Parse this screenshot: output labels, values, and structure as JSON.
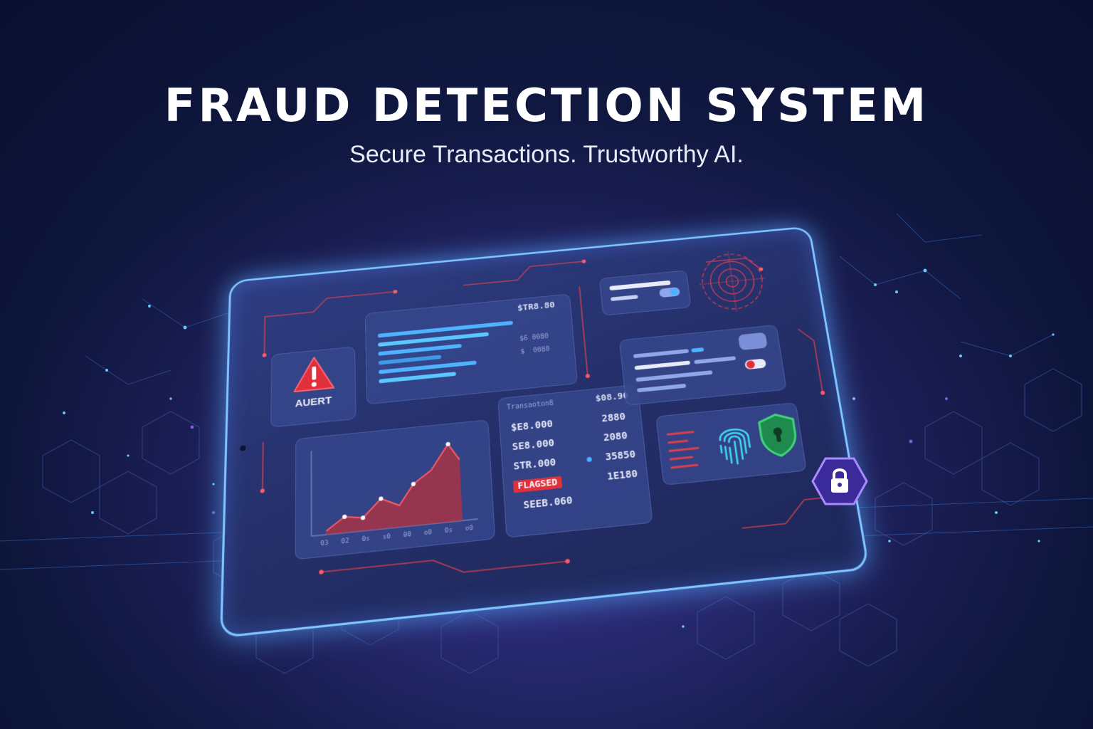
{
  "header": {
    "title": "FRAUD DETECTION SYSTEM",
    "subtitle": "Secure Transactions. Trustworthy AI."
  },
  "alert_card": {
    "label": "AUERT"
  },
  "bars_card": {
    "top_value": "$TR8.80",
    "row_values": [
      "$6 0080",
      "$  0080"
    ],
    "bar_color": "#4fb2ff"
  },
  "chart_card": {
    "tick_labels": [
      "03",
      "02",
      "0s",
      "s0",
      "00",
      "o0",
      "0s",
      "o0"
    ],
    "line_color": "#e04650",
    "fill_color": "#b8303c"
  },
  "transactions": {
    "header_left": "Transaoton8",
    "header_right": "$08.90",
    "rows": [
      {
        "left": "$E8.000",
        "right": "2880"
      },
      {
        "left": "SE8.000",
        "right": "2080"
      },
      {
        "left": "STR.000",
        "right": "35850"
      },
      {
        "left": "FLAGSED",
        "right": "1E180",
        "flagged": true
      },
      {
        "left": "SEEB.060",
        "right": ""
      }
    ]
  },
  "colors": {
    "accent": "#4fb2ff",
    "alert_red": "#e0303c",
    "shield_green": "#3fd67a",
    "fingerprint_cyan": "#3fd7f0",
    "lock_purple": "#7a4dff"
  }
}
